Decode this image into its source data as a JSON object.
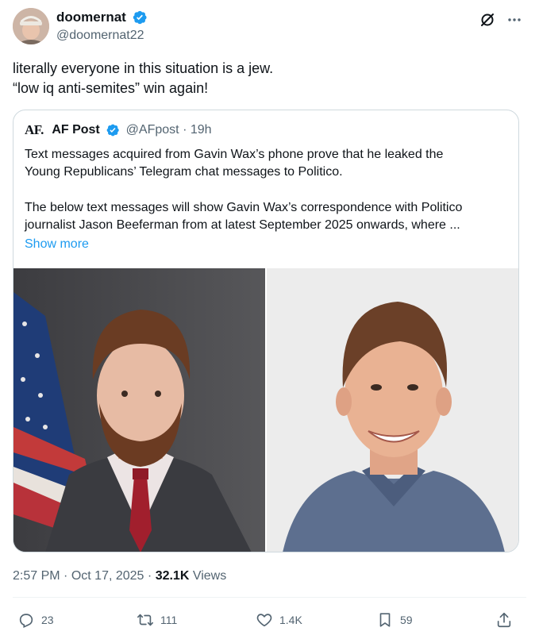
{
  "author": {
    "display_name": "doomernat",
    "handle": "@doomernat22"
  },
  "tweet": {
    "line1": "literally everyone in this situation is a jew.",
    "line2": "“low iq anti-semites” win again!"
  },
  "quote": {
    "logo": "AF.",
    "name": "AF Post",
    "handle": "@AFpost",
    "separator": "·",
    "age": "19h",
    "para1_line1": "Text messages acquired from Gavin Wax’s phone prove that he leaked the",
    "para1_line2": "Young Republicans’ Telegram chat messages to Politico.",
    "para2_line1": "The below text messages will show Gavin Wax’s correspondence with Politico",
    "para2_line2": "journalist Jason Beeferman from at latest September 2025 onwards, where ...",
    "show_more": "Show more"
  },
  "meta": {
    "time": "2:57 PM",
    "separator": "·",
    "date": "Oct 17, 2025",
    "views_count": "32.1K",
    "views_label": "Views"
  },
  "actions": {
    "replies": "23",
    "reposts": "111",
    "likes": "1.4K",
    "bookmarks": "59"
  },
  "colors": {
    "accent": "#1d9bf0",
    "text": "#0f1419",
    "muted": "#536471",
    "border": "#cfd9de"
  }
}
